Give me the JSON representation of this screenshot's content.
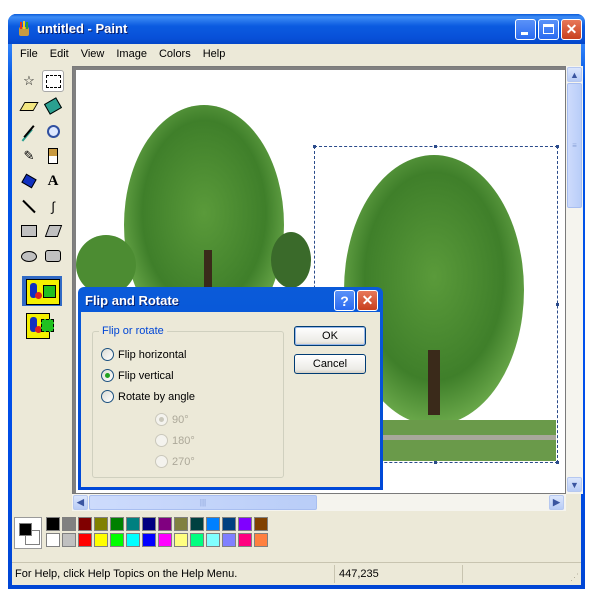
{
  "window": {
    "title": "untitled - Paint",
    "icons": {
      "app": "paint-app-icon",
      "minimize": "minimize-icon",
      "maximize": "maximize-icon",
      "close": "close-icon"
    }
  },
  "menubar": {
    "items": [
      {
        "label": "File"
      },
      {
        "label": "Edit"
      },
      {
        "label": "View"
      },
      {
        "label": "Image"
      },
      {
        "label": "Colors"
      },
      {
        "label": "Help"
      }
    ]
  },
  "toolbox": {
    "tools": [
      {
        "name": "free-form-select",
        "glyph": "☆",
        "selected": false
      },
      {
        "name": "select",
        "glyph": "⬚",
        "selected": true
      },
      {
        "name": "eraser",
        "glyph": "▱",
        "selected": false
      },
      {
        "name": "fill-with-color",
        "glyph": "◈",
        "selected": false
      },
      {
        "name": "pick-color",
        "glyph": "⁄",
        "selected": false
      },
      {
        "name": "magnifier",
        "glyph": "⚲",
        "selected": false
      },
      {
        "name": "pencil",
        "glyph": "✎",
        "selected": false
      },
      {
        "name": "brush",
        "glyph": "♙",
        "selected": false
      },
      {
        "name": "airbrush",
        "glyph": "◆",
        "selected": false
      },
      {
        "name": "text",
        "glyph": "A",
        "selected": false
      },
      {
        "name": "line",
        "glyph": "╲",
        "selected": false
      },
      {
        "name": "curve",
        "glyph": "∫",
        "selected": false
      },
      {
        "name": "rectangle",
        "glyph": "▭",
        "selected": false
      },
      {
        "name": "polygon",
        "glyph": "▱",
        "selected": false
      },
      {
        "name": "ellipse",
        "glyph": "⬭",
        "selected": false
      },
      {
        "name": "rounded-rectangle",
        "glyph": "▢",
        "selected": false
      }
    ],
    "options": [
      {
        "name": "opaque-selection",
        "selected": true
      },
      {
        "name": "transparent-selection",
        "selected": false
      }
    ]
  },
  "palette": {
    "foreground": "#000000",
    "background": "#ffffff",
    "top_row": [
      "#000000",
      "#808080",
      "#800000",
      "#808000",
      "#008000",
      "#008080",
      "#000080",
      "#800080",
      "#808040",
      "#004040",
      "#0080ff",
      "#004080",
      "#8000ff",
      "#804000"
    ],
    "bottom_row": [
      "#ffffff",
      "#c0c0c0",
      "#ff0000",
      "#ffff00",
      "#00ff00",
      "#00ffff",
      "#0000ff",
      "#ff00ff",
      "#ffff80",
      "#00ff80",
      "#80ffff",
      "#8080ff",
      "#ff0080",
      "#ff8040"
    ]
  },
  "statusbar": {
    "help_text": "For Help, click Help Topics on the Help Menu.",
    "coordinates": "447,235"
  },
  "dialog": {
    "title": "Flip and Rotate",
    "group_label": "Flip or rotate",
    "options": [
      {
        "label": "Flip horizontal",
        "checked": false,
        "disabled": false
      },
      {
        "label": "Flip vertical",
        "checked": true,
        "disabled": false
      },
      {
        "label": "Rotate by angle",
        "checked": false,
        "disabled": false
      }
    ],
    "angles": [
      {
        "label": "90°",
        "checked": true,
        "disabled": true
      },
      {
        "label": "180°",
        "checked": false,
        "disabled": true
      },
      {
        "label": "270°",
        "checked": false,
        "disabled": true
      }
    ],
    "ok_label": "OK",
    "cancel_label": "Cancel",
    "help_glyph": "?",
    "close_glyph": "✕"
  },
  "canvas": {
    "content": "two tree photographs, right one within a dashed selection"
  },
  "scrollbars": {
    "up": "▲",
    "down": "▼",
    "left": "◀",
    "right": "▶",
    "grip": "|||"
  }
}
